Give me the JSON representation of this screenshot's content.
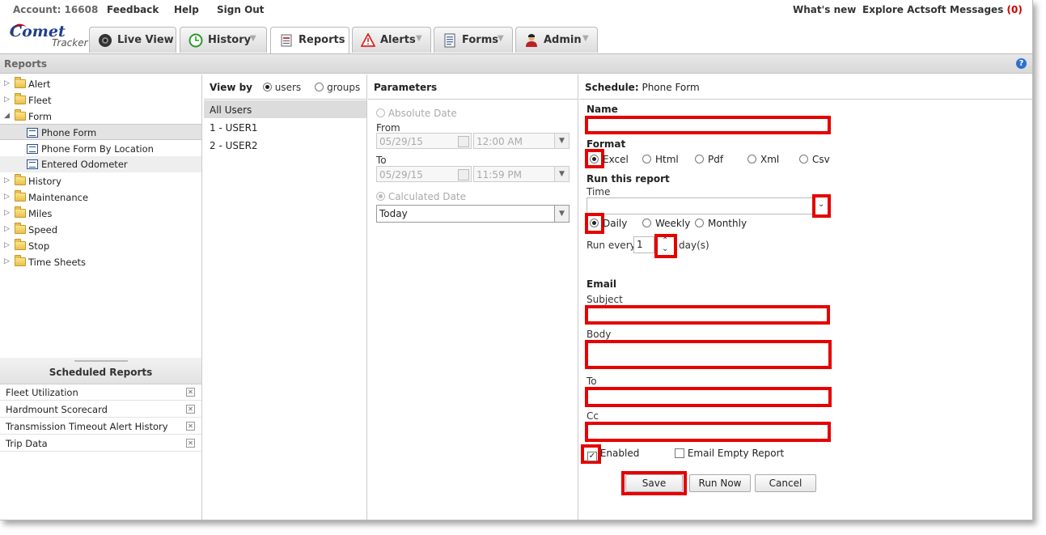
{
  "topbar": {
    "account": "Account: 16608",
    "feedback": "Feedback",
    "help": "Help",
    "sign_out": "Sign Out",
    "whats_new": "What's new",
    "explore": "Explore Actsoft",
    "messages_label": "Messages",
    "messages_count": "(0)"
  },
  "logo": {
    "brand": "Comet",
    "sub": "Tracker"
  },
  "tabs": [
    {
      "label": "Live View",
      "icon": "camera-icon"
    },
    {
      "label": "History",
      "icon": "clock-icon",
      "dropdown": true
    },
    {
      "label": "Reports",
      "icon": "report-icon",
      "active": true
    },
    {
      "label": "Alerts",
      "icon": "warning-icon",
      "dropdown": true
    },
    {
      "label": "Forms",
      "icon": "document-icon",
      "dropdown": true
    },
    {
      "label": "Admin",
      "icon": "user-icon",
      "dropdown": true
    }
  ],
  "page": {
    "title": "Reports",
    "help_glyph": "?"
  },
  "tree": [
    {
      "label": "Alert",
      "expanded": false
    },
    {
      "label": "Fleet",
      "expanded": false
    },
    {
      "label": "Form",
      "expanded": true,
      "children": [
        "Phone Form",
        "Phone Form By Location",
        "Entered Odometer"
      ]
    },
    {
      "label": "History",
      "expanded": false
    },
    {
      "label": "Maintenance",
      "expanded": false
    },
    {
      "label": "Miles",
      "expanded": false
    },
    {
      "label": "Speed",
      "expanded": false
    },
    {
      "label": "Stop",
      "expanded": false
    },
    {
      "label": "Time Sheets",
      "expanded": false
    }
  ],
  "scheduled": {
    "title": "Scheduled Reports",
    "items": [
      "Fleet Utilization",
      "Hardmount Scorecard",
      "Transmission Timeout Alert History",
      "Trip Data"
    ]
  },
  "viewby": {
    "title": "View by",
    "option_users": "users",
    "option_groups": "groups",
    "selected": "users",
    "rows": [
      "All Users",
      "1 - USER1",
      "2 - USER2"
    ]
  },
  "params": {
    "title": "Parameters",
    "absolute_date": "Absolute Date",
    "from_label": "From",
    "from_date": "05/29/15",
    "from_time": "12:00 AM",
    "to_label": "To",
    "to_date": "05/29/15",
    "to_time": "11:59 PM",
    "calculated_date": "Calculated Date",
    "calc_value": "Today"
  },
  "schedule": {
    "title_bold": "Schedule:",
    "title_value": "Phone Form",
    "name_label": "Name",
    "name_value": "",
    "format_label": "Format",
    "formats": [
      "Excel",
      "Html",
      "Pdf",
      "Xml",
      "Csv"
    ],
    "format_selected": "Excel",
    "run_label": "Run this report",
    "time_label": "Time",
    "time_value": "",
    "frequencies": [
      "Daily",
      "Weekly",
      "Monthly"
    ],
    "frequency_selected": "Daily",
    "run_every_label": "Run every",
    "run_every_value": "1",
    "run_every_unit": "day(s)",
    "email_label": "Email",
    "subject_label": "Subject",
    "body_label": "Body",
    "to_label": "To",
    "cc_label": "Cc",
    "enabled_label": "Enabled",
    "enabled_checked": true,
    "empty_report_label": "Email Empty Report",
    "empty_report_checked": false,
    "save": "Save",
    "run_now": "Run Now",
    "cancel": "Cancel"
  },
  "colors": {
    "highlight": "#e60000",
    "brand": "#1d3f8a",
    "messages": "#cc0000"
  }
}
